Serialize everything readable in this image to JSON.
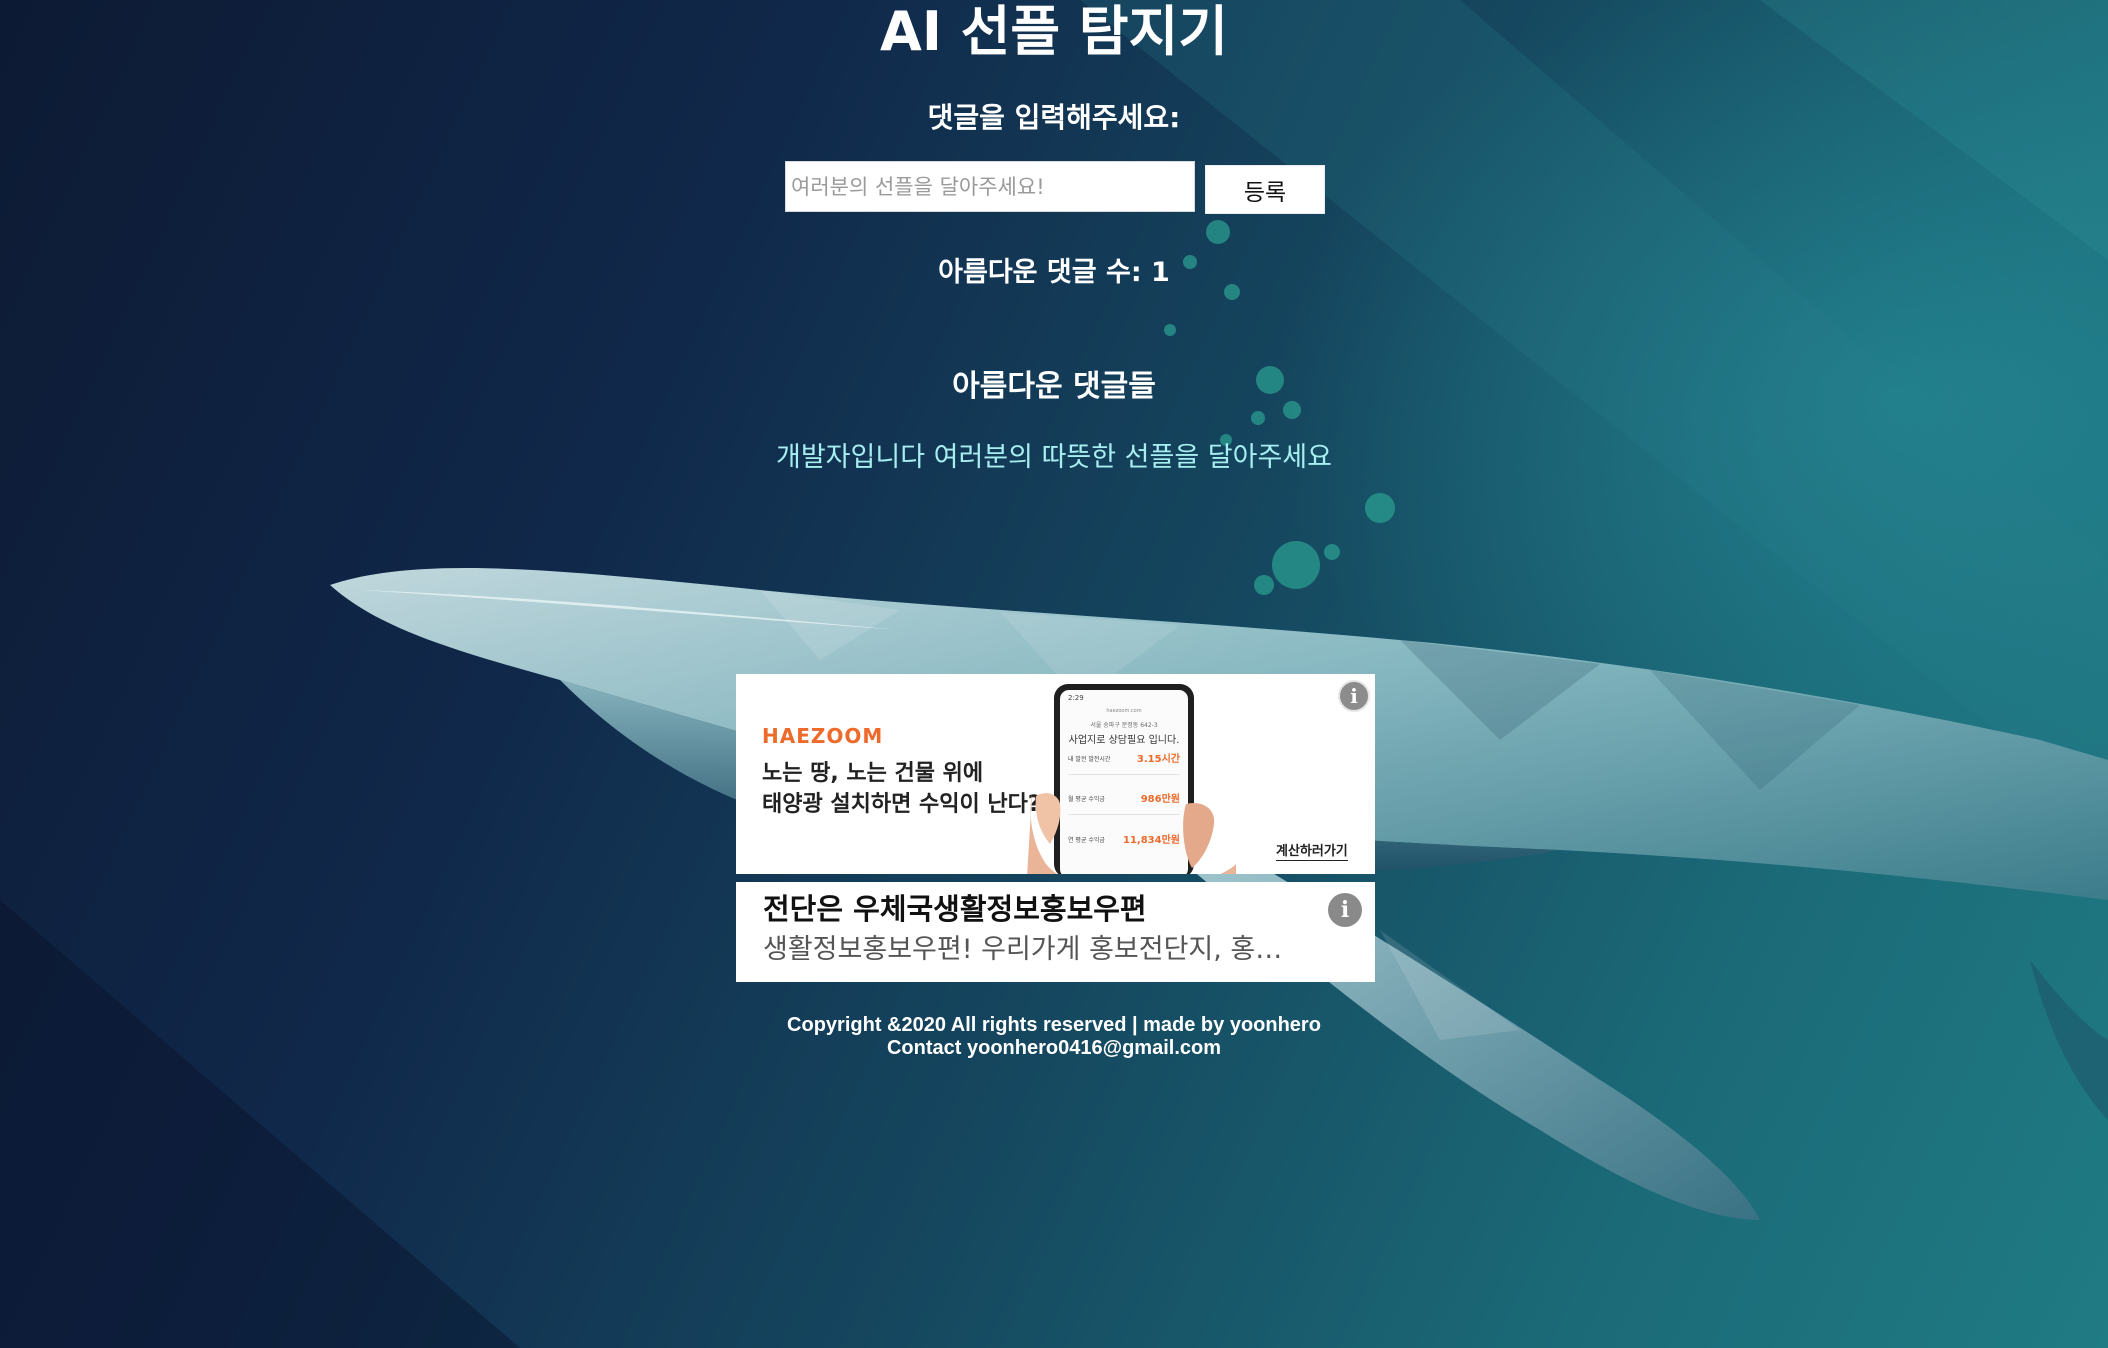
{
  "header": {
    "title": "AI 선플 탐지기"
  },
  "form": {
    "prompt": "댓글을 입력해주세요:",
    "placeholder": "여러분의 선플을 달아주세요!",
    "submit_label": "등록"
  },
  "stats": {
    "count_text": "아름다운 댓글 수: 1"
  },
  "comments": {
    "heading": "아름다운 댓글들",
    "items": [
      "개발자입니다 여러분의 따뜻한 선플을 달아주세요"
    ]
  },
  "ads": [
    {
      "brand": "HAEZOOM",
      "headline_line1": "노는 땅, 노는 건물 위에",
      "headline_line2": "태양광 설치하면 수익이 난다?",
      "cta": "계산하러가기",
      "phone": {
        "time": "2:29",
        "url": "haezoom.com",
        "address": "서울 송파구 문정동 642-3",
        "consult": "사업지로 상담필요 입니다.",
        "rows": [
          {
            "label": "내 발전 발전시간",
            "value": "3.15시간"
          },
          {
            "label": "월 평균 수익금",
            "value": "986만원"
          },
          {
            "label": "연 평균 수익금",
            "value": "11,834만원"
          }
        ]
      },
      "info_icon": "i"
    },
    {
      "title": "전단은 우체국생활정보홍보우편",
      "description": "생활정보홍보우편! 우리가게 홍보전단지, 홍보물 발송",
      "info_icon": "i"
    }
  ],
  "footer": {
    "line1": "Copyright &2020 All rights reserved | made by yoonhero",
    "line2": "Contact yoonhero0416@gmail.com"
  },
  "colors": {
    "accent_text": "#a6eef0",
    "ad_brand": "#ee6a2b",
    "background_dark": "#0d1a33",
    "background_teal": "#1f7b84"
  }
}
